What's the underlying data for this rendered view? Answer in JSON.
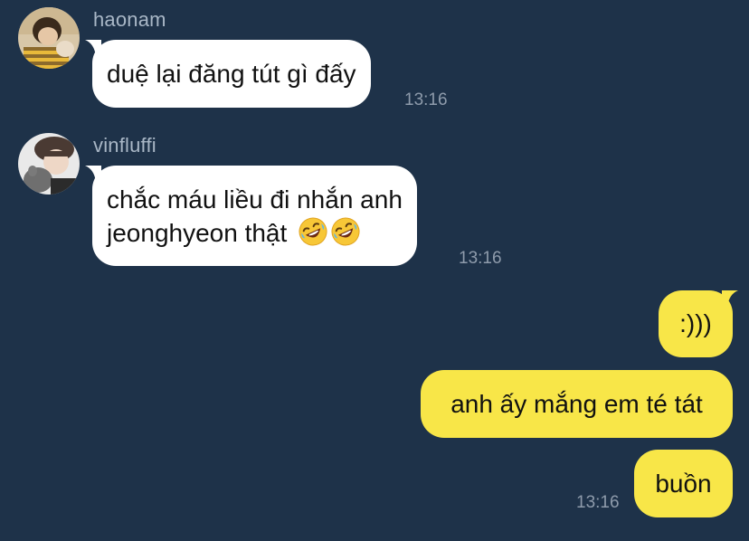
{
  "chat": {
    "messages": [
      {
        "sender": "haonam",
        "text": "duệ lại đăng tút gì đấy",
        "time": "13:16"
      },
      {
        "sender": "vinfluffi",
        "text_line1": "chắc máu liều đi nhắn anh",
        "text_line2": "jeonghyeon thật",
        "emojis": [
          "rolling-on-floor-laughing",
          "rolling-on-floor-laughing"
        ],
        "time": "13:16"
      },
      {
        "text": ":)))"
      },
      {
        "text": "anh ấy mắng em té tát"
      },
      {
        "text": "buồn",
        "time": "13:16"
      }
    ]
  },
  "colors": {
    "background": "#1e3249",
    "incoming_bubble": "#ffffff",
    "outgoing_bubble": "#f8e648",
    "sender_name": "#a9b7c6",
    "timestamp": "#8e9bab"
  }
}
